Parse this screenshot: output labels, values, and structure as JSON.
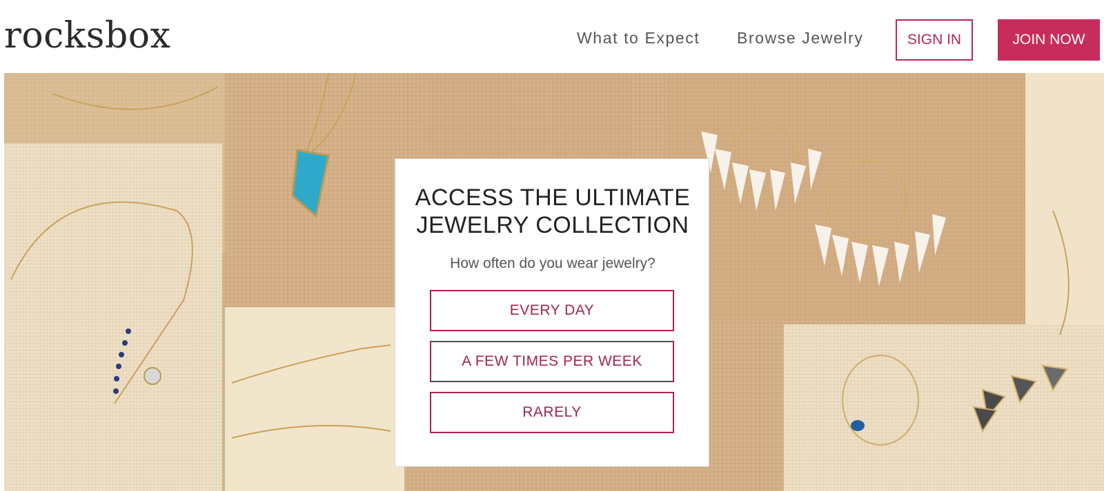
{
  "header": {
    "logo_text": "rocksbox",
    "nav": {
      "what_to_expect": "What to Expect",
      "browse_jewelry": "Browse Jewelry"
    },
    "sign_in_label": "SIGN IN",
    "join_now_label": "JOIN NOW"
  },
  "quiz": {
    "title_line1": "ACCESS THE ULTIMATE",
    "title_line2": "JEWELRY COLLECTION",
    "question": "How often do you wear jewelry?",
    "options": [
      "EVERY DAY",
      "A FEW TIMES PER WEEK",
      "RARELY"
    ]
  },
  "colors": {
    "brand": "#c72d5c",
    "accent_outline": "#a3234f",
    "burlap": "#d9b891",
    "linen": "#efe2c9"
  }
}
